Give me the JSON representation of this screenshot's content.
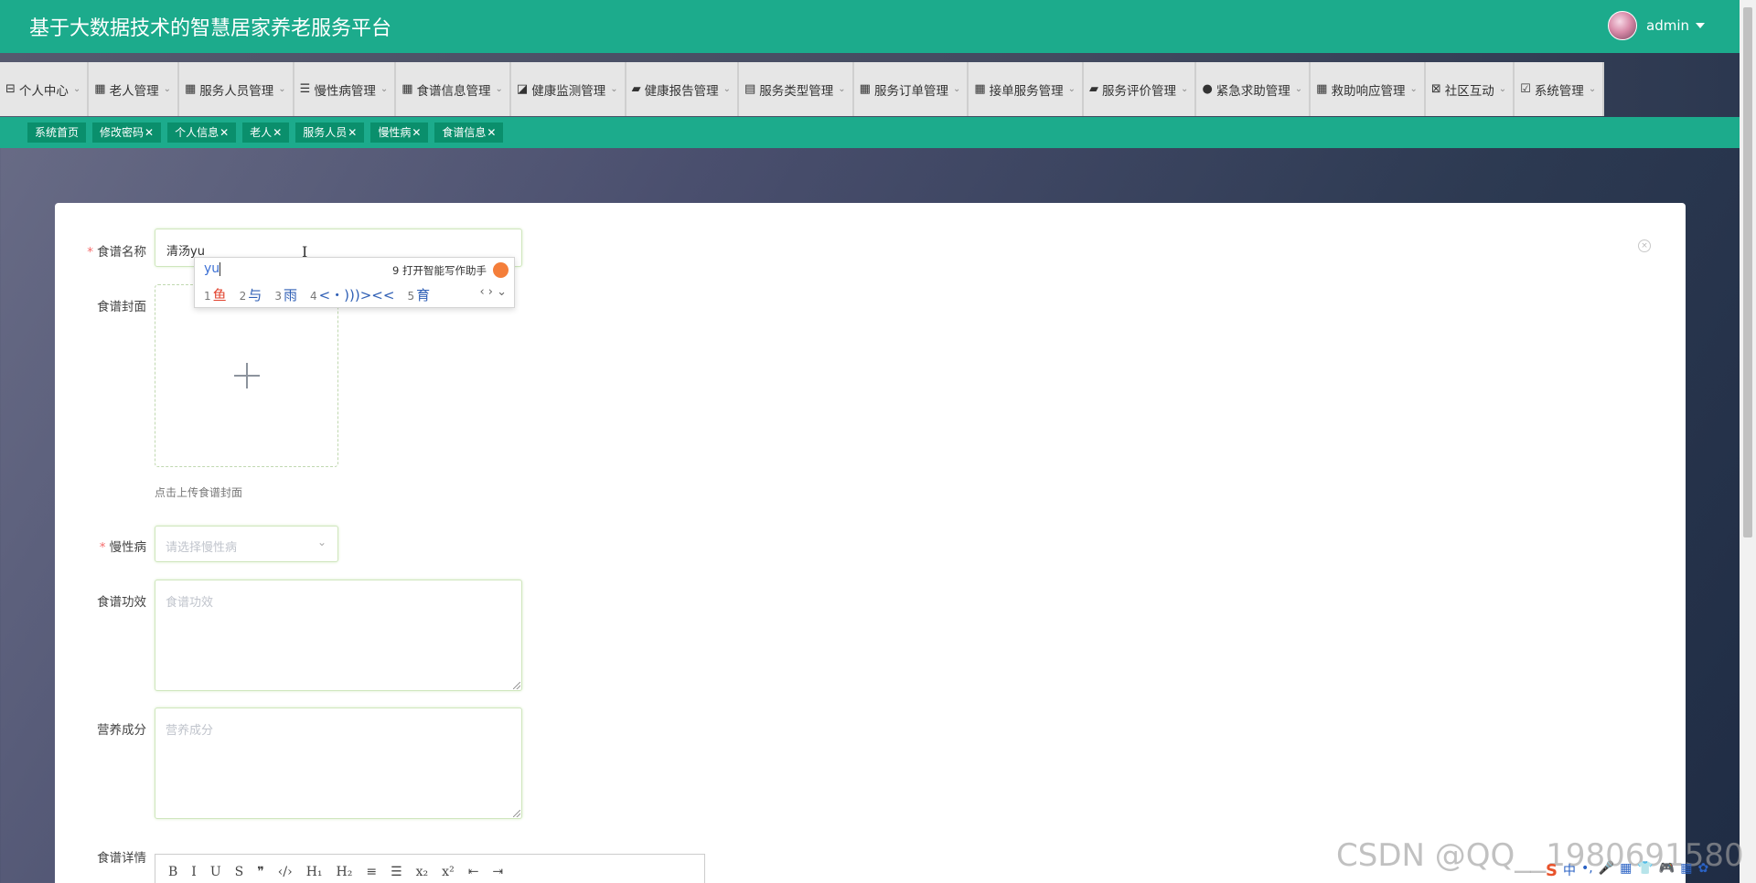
{
  "header": {
    "title": "基于大数据技术的智慧居家养老服务平台",
    "username": "admin"
  },
  "menu": [
    {
      "icon": "⊟",
      "label": "个人中心"
    },
    {
      "icon": "▦",
      "label": "老人管理"
    },
    {
      "icon": "▦",
      "label": "服务人员管理"
    },
    {
      "icon": "☰",
      "label": "慢性病管理"
    },
    {
      "icon": "▦",
      "label": "食谱信息管理"
    },
    {
      "icon": "◪",
      "label": "健康监测管理"
    },
    {
      "icon": "▰",
      "label": "健康报告管理"
    },
    {
      "icon": "▤",
      "label": "服务类型管理"
    },
    {
      "icon": "▦",
      "label": "服务订单管理"
    },
    {
      "icon": "▦",
      "label": "接单服务管理"
    },
    {
      "icon": "▰",
      "label": "服务评价管理"
    },
    {
      "icon": "●",
      "label": "紧急求助管理"
    },
    {
      "icon": "▦",
      "label": "救助响应管理"
    },
    {
      "icon": "⊠",
      "label": "社区互动"
    },
    {
      "icon": "☑",
      "label": "系统管理"
    }
  ],
  "tags": [
    {
      "label": "系统首页",
      "closable": false
    },
    {
      "label": "修改密码",
      "closable": true
    },
    {
      "label": "个人信息",
      "closable": true
    },
    {
      "label": "老人",
      "closable": true
    },
    {
      "label": "服务人员",
      "closable": true
    },
    {
      "label": "慢性病",
      "closable": true
    },
    {
      "label": "食谱信息",
      "closable": true
    }
  ],
  "tag_close": "✕",
  "form": {
    "name_label": "食谱名称",
    "name_value": "清汤yu",
    "cover_label": "食谱封面",
    "cover_hint": "点击上传食谱封面",
    "disease_label": "慢性病",
    "disease_placeholder": "请选择慢性病",
    "effect_label": "食谱功效",
    "effect_placeholder": "食谱功效",
    "nutrition_label": "营养成分",
    "nutrition_placeholder": "营养成分",
    "detail_label": "食谱详情"
  },
  "editor_toolbar": [
    "B",
    "I",
    "U",
    "S",
    "❞",
    "‹/›",
    "H₁",
    "H₂",
    "≡",
    "☰",
    "x₂",
    "x²",
    "⇤",
    "⇥"
  ],
  "ime": {
    "input": "yu",
    "assist": "9 打开智能写作助手",
    "candidates": [
      {
        "n": "1",
        "text": "鱼"
      },
      {
        "n": "2",
        "text": "与"
      },
      {
        "n": "3",
        "text": "雨"
      },
      {
        "n": "4",
        "text": "<・)))><<"
      },
      {
        "n": "5",
        "text": "育"
      }
    ],
    "nav": "‹ › ⌄"
  },
  "watermark": "CSDN @QQ__1980691580",
  "tray_icons": [
    "S",
    "中",
    "•,",
    "🎤",
    "▦",
    "👕",
    "🎮",
    "▦",
    "✿"
  ]
}
